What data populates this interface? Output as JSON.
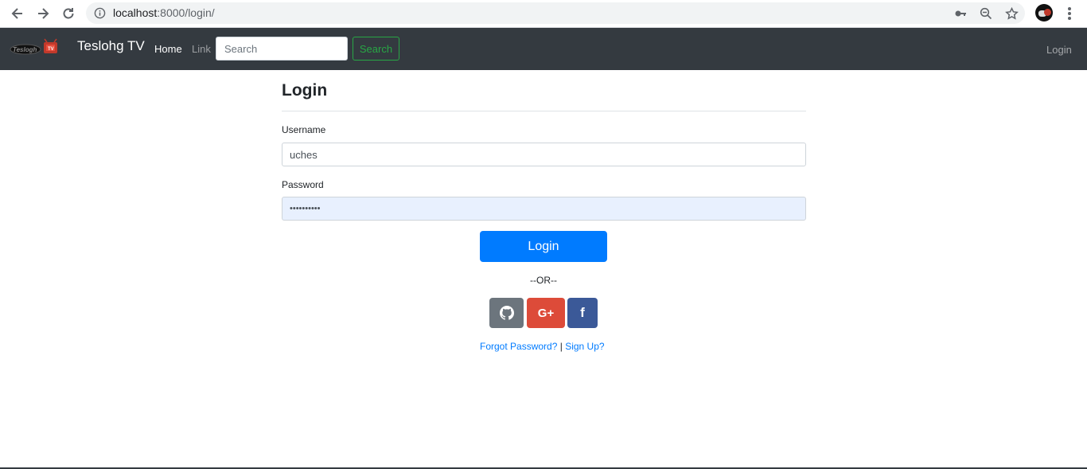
{
  "browser": {
    "url_host": "localhost",
    "url_path": ":8000/login/"
  },
  "navbar": {
    "brand": "Teslohg TV",
    "logo_text": "Teslohg TV",
    "home": "Home",
    "link": "Link",
    "search_placeholder": "Search",
    "search_button": "Search",
    "login": "Login"
  },
  "form": {
    "title": "Login",
    "username_label": "Username",
    "username_value": "uches",
    "password_label": "Password",
    "password_value": "••••••••••",
    "submit": "Login",
    "or": "--OR--",
    "social": {
      "google_glyph": "G+",
      "facebook_glyph": "f"
    },
    "forgot": "Forgot Password?",
    "separator": " | ",
    "signup": "Sign Up?"
  },
  "colors": {
    "navbar_bg": "#343a40",
    "primary": "#007bff",
    "success": "#28a745",
    "github": "#6c757d",
    "google": "#dd4b39",
    "facebook": "#3b5998"
  }
}
